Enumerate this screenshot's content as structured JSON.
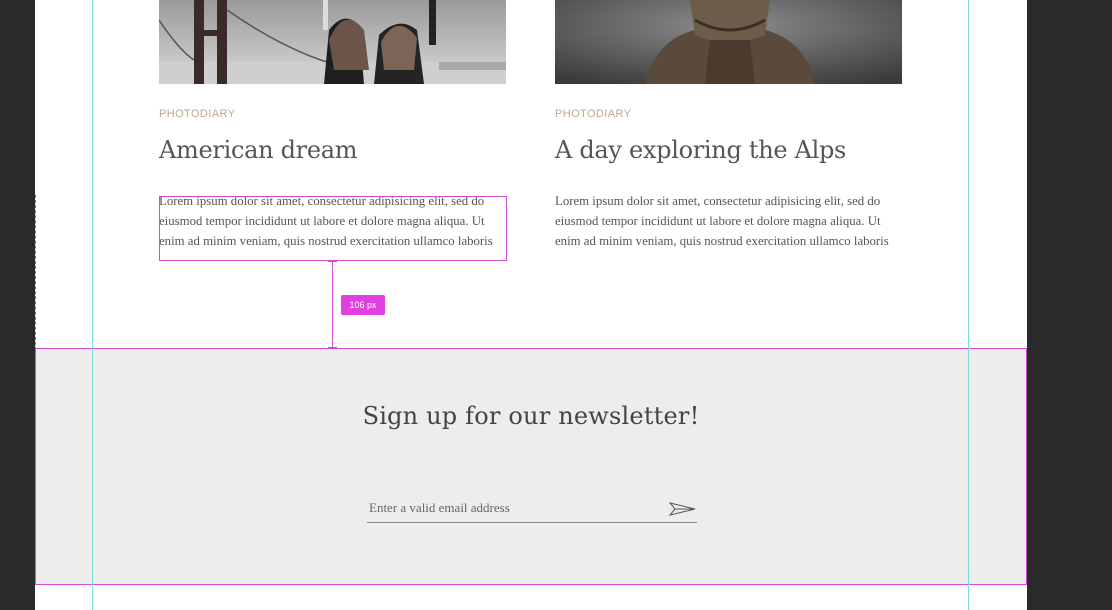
{
  "cards": [
    {
      "category": "PHOTODIARY",
      "title": "American dream",
      "text": "Lorem ipsum dolor sit amet, consectetur adipisicing elit, sed do eiusmod tempor incididunt ut labore et dolore magna aliqua. Ut enim ad minim veniam, quis nostrud exercitation ullamco laboris"
    },
    {
      "category": "PHOTODIARY",
      "title": "A day exploring the Alps",
      "text": "Lorem ipsum dolor sit amet, consectetur adipisicing elit, sed do eiusmod tempor incididunt ut labore et dolore magna aliqua. Ut enim ad minim veniam, quis nostrud exercitation ullamco laboris"
    }
  ],
  "measure": {
    "label": "106 px"
  },
  "newsletter": {
    "title": "Sign up for our newsletter!",
    "email_placeholder": "Enter a valid email address"
  },
  "icons": {
    "send": "paper-plane-icon"
  },
  "colors": {
    "guide": "#7fdcdc",
    "selection": "#d24bd2",
    "category": "#bca88a",
    "newsletter_bg": "#efedeb"
  }
}
